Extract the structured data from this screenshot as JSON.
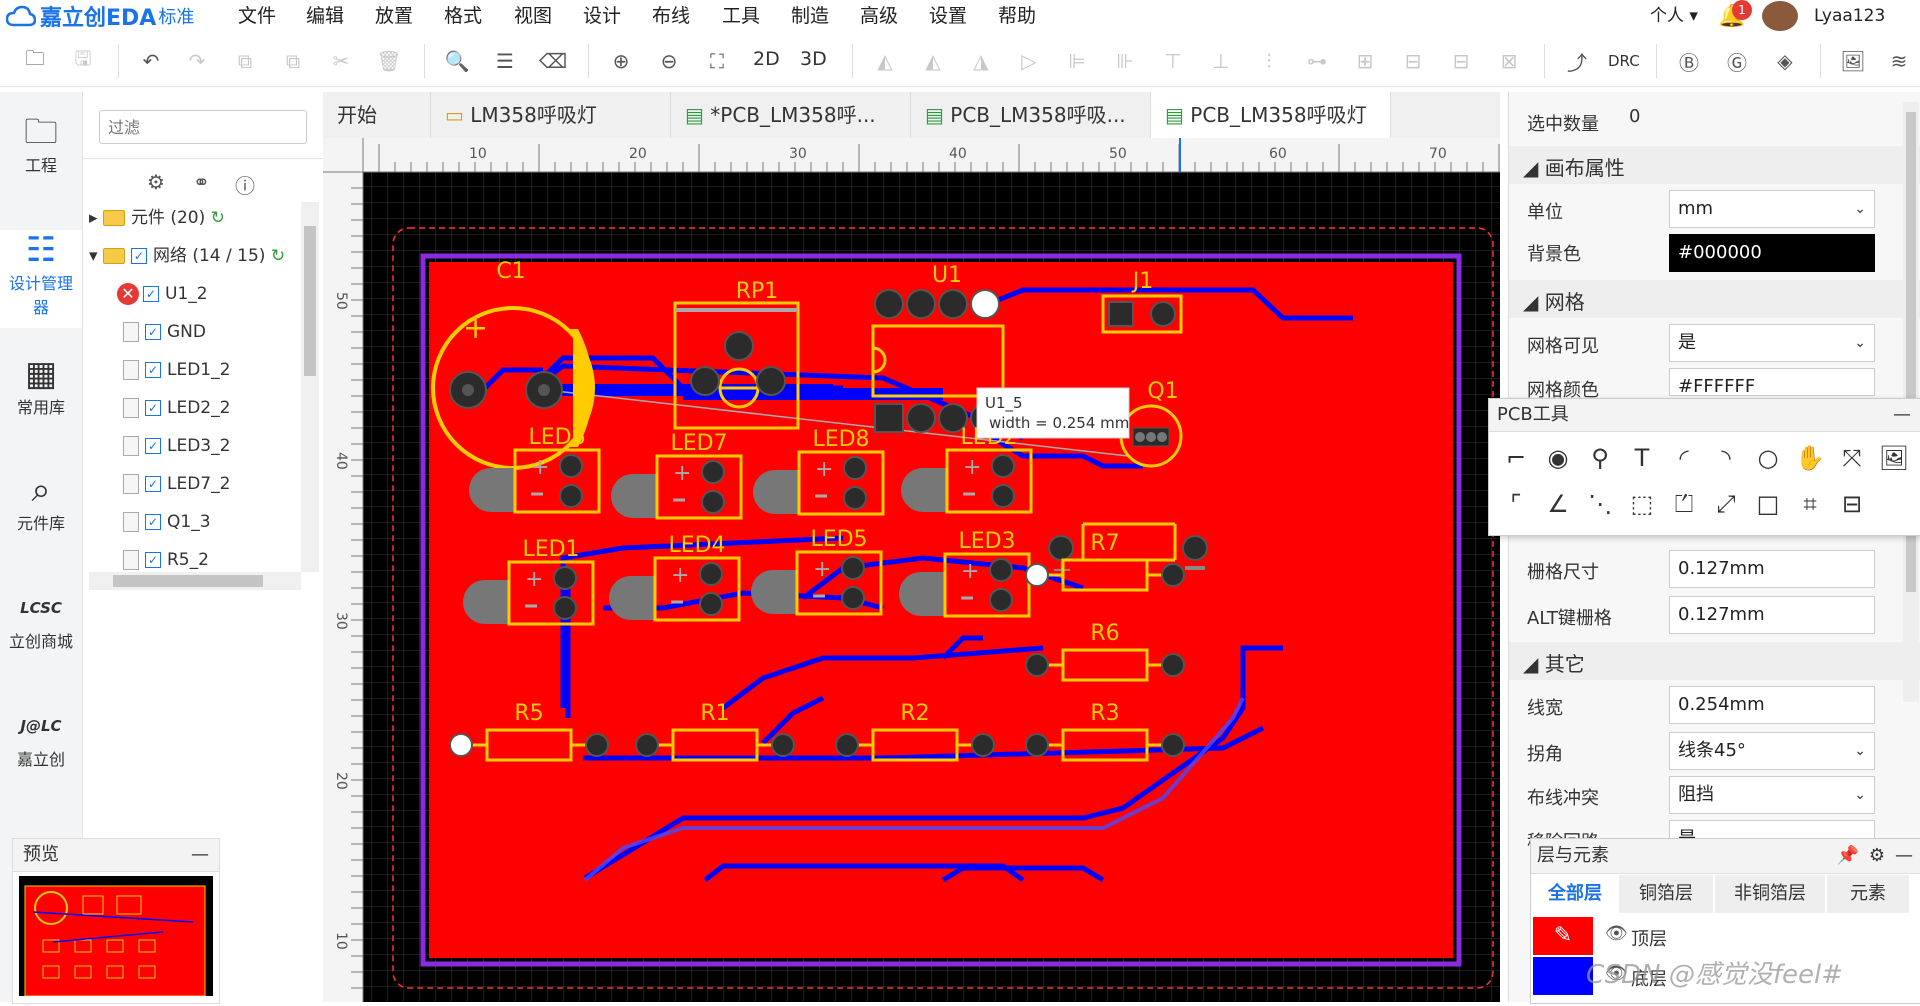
{
  "app": {
    "brand": "嘉立创EDA",
    "edition": "标准"
  },
  "menu": [
    "文件",
    "编辑",
    "放置",
    "格式",
    "视图",
    "设计",
    "布线",
    "工具",
    "制造",
    "高级",
    "设置",
    "帮助"
  ],
  "user": {
    "personal": "个人",
    "notif_count": "1",
    "name": "Lyaa123"
  },
  "toolbar": {
    "view_2d": "2D",
    "view_3d": "3D",
    "drc": "DRC"
  },
  "leftbar": [
    {
      "label": "工程",
      "icon": "folder-icon"
    },
    {
      "label": "设计管理器",
      "icon": "list-icon"
    },
    {
      "label": "常用库",
      "icon": "chip-icon"
    },
    {
      "label": "元件库",
      "icon": "search-chip-icon"
    },
    {
      "label": "立创商城",
      "icon": "lcsc-logo"
    },
    {
      "label": "嘉立创",
      "icon": "jlc-logo"
    }
  ],
  "panel": {
    "filter_placeholder": "过滤",
    "tree": [
      {
        "label": "元件 (20)",
        "type": "folder",
        "indent": 0
      },
      {
        "label": "网络 (14 / 15)",
        "type": "folder",
        "indent": 0
      },
      {
        "label": "U1_2",
        "type": "error",
        "indent": 1
      },
      {
        "label": "GND",
        "type": "net",
        "indent": 1
      },
      {
        "label": "LED1_2",
        "type": "net",
        "indent": 1
      },
      {
        "label": "LED2_2",
        "type": "net",
        "indent": 1
      },
      {
        "label": "LED3_2",
        "type": "net",
        "indent": 1
      },
      {
        "label": "LED7_2",
        "type": "net",
        "indent": 1
      },
      {
        "label": "Q1_3",
        "type": "net",
        "indent": 1
      },
      {
        "label": "R5_2",
        "type": "net",
        "indent": 1
      }
    ],
    "preview_title": "预览"
  },
  "tabs": [
    "开始",
    "LM358呼吸灯",
    "*PCB_LM358呼...",
    "PCB_LM358呼吸...",
    "PCB_LM358呼吸灯"
  ],
  "ruler": [
    "10",
    "20",
    "30",
    "40",
    "50",
    "60",
    "70"
  ],
  "ruler_v": [
    "50",
    "40",
    "30",
    "20",
    "10"
  ],
  "components": {
    "labels": [
      "C1",
      "RP1",
      "U1",
      "J1",
      "Q1",
      "LED6",
      "LED7",
      "LED8",
      "LED2",
      "LED1",
      "LED4",
      "LED5",
      "LED3",
      "R7",
      "R6",
      "R5",
      "R1",
      "R2",
      "R3"
    ]
  },
  "tooltip": {
    "net": "U1_5",
    "width": "width = 0.254 mm"
  },
  "props": {
    "selected_label": "选中数量",
    "selected_value": "0",
    "canvas_section": "画布属性",
    "unit_label": "单位",
    "unit_value": "mm",
    "bg_label": "背景色",
    "bg_value": "#000000",
    "grid_section": "网格",
    "grid_visible_label": "网格可见",
    "grid_visible_value": "是",
    "grid_color_label": "网格颜色",
    "grid_color_value": "#FFFFFF",
    "snap_label": "栅格尺寸",
    "snap_value": "0.127mm",
    "alt_label": "ALT键栅格",
    "alt_value": "0.127mm",
    "other_section": "其它",
    "width_label": "线宽",
    "width_value": "0.254mm",
    "corner_label": "拐角",
    "corner_value": "线条45°",
    "conflict_label": "布线冲突",
    "conflict_value": "阻挡",
    "remove_label": "移除回路",
    "remove_value": "是"
  },
  "pcbtools": {
    "title": "PCB工具"
  },
  "layers": {
    "title": "层与元素",
    "tabs": [
      "全部层",
      "铜箔层",
      "非铜箔层",
      "元素"
    ],
    "rows": [
      {
        "name": "顶层",
        "color": "#ff0000"
      },
      {
        "name": "底层",
        "color": "#0000ff"
      }
    ]
  },
  "watermark": "CSDN @感觉没feel#",
  "colors": {
    "board": "#ff0000",
    "silk": "#ffcc00",
    "bottom": "#0000ff",
    "pad": "#2b2b2b"
  }
}
